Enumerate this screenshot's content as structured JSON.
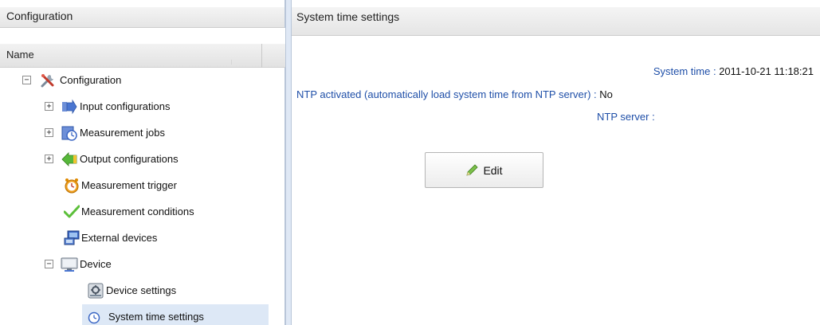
{
  "left_panel": {
    "title": "Configuration",
    "column_header": "Name"
  },
  "tree": {
    "root": {
      "label": "Configuration",
      "icon": "tools-icon",
      "toggle": "−"
    },
    "items": [
      {
        "label": "Input configurations",
        "icon": "input-arrow-icon",
        "toggle": "+"
      },
      {
        "label": "Measurement jobs",
        "icon": "measurement-jobs-icon",
        "toggle": "+"
      },
      {
        "label": "Output configurations",
        "icon": "output-arrow-icon",
        "toggle": "+"
      },
      {
        "label": "Measurement trigger",
        "icon": "alarm-clock-icon"
      },
      {
        "label": "Measurement conditions",
        "icon": "checkmark-icon"
      },
      {
        "label": "External devices",
        "icon": "external-devices-icon"
      },
      {
        "label": "Device",
        "icon": "monitor-icon",
        "toggle": "−"
      },
      {
        "label": "Device settings",
        "icon": "device-settings-icon"
      },
      {
        "label": "System time settings",
        "icon": "clock-icon",
        "selected": true
      }
    ]
  },
  "right_panel": {
    "title": "System time settings",
    "system_time_label": "System time :",
    "system_time_value": "2011-10-21 11:18:21",
    "ntp_activated_label": "NTP activated (automatically load system time from NTP server) :",
    "ntp_activated_value": "No",
    "ntp_server_label": "NTP server :",
    "ntp_server_value": "",
    "edit_label": "Edit"
  },
  "colors": {
    "label_blue": "#1f4fa8",
    "selection": "#dde8f6",
    "splitter": "#dfe8f5"
  }
}
